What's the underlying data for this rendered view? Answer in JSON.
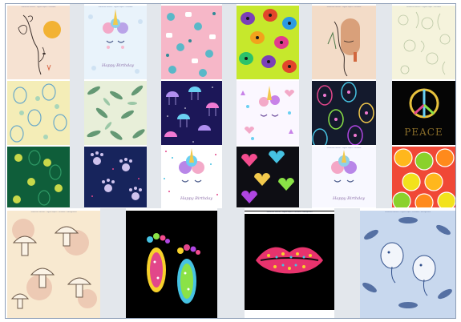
{
  "captions": {
    "top_small": "Seamless Pattern - Digital Paper - Printable",
    "wide": "Seamless Pattern - Digital Paper - Printable - Background"
  },
  "stamps": {
    "birthday_1": "Happy Birthday",
    "birthday_2": "Happy Birthday",
    "birthday_3": "Happy Birthday",
    "peace": "PEACE"
  },
  "tiles": [
    {
      "name": "line-art-face-flowers-pattern",
      "colors": {
        "bg": "#f6e2d2",
        "accent": "#f2b233"
      }
    },
    {
      "name": "unicorn-floral-card",
      "colors": {
        "bg": "#e9f3fb",
        "accent": "#f3a9c8"
      }
    },
    {
      "name": "pink-teal-doodle-pattern",
      "colors": {
        "bg": "#f6b7c8",
        "accent": "#5ab8c8"
      }
    },
    {
      "name": "colorful-ladybug-pattern",
      "colors": {
        "bg": "#c6e82c",
        "accent": "#7b3fb8"
      }
    },
    {
      "name": "abstract-face-art",
      "colors": {
        "bg": "#f3dcc8",
        "accent": "#d2673e"
      }
    },
    {
      "name": "pale-botanical-sketch-pattern",
      "colors": {
        "bg": "#f5f3dc",
        "accent": "#b9c6a3"
      }
    },
    {
      "name": "pastel-badminton-pattern",
      "colors": {
        "bg": "#f4edb7",
        "accent": "#6aa9c9"
      }
    },
    {
      "name": "green-leaf-swirl-pattern",
      "colors": {
        "bg": "#e8efd9",
        "accent": "#4d8a63"
      }
    },
    {
      "name": "jellyfish-night-pattern",
      "colors": {
        "bg": "#1c1758",
        "accent": "#b08ff0"
      }
    },
    {
      "name": "unicorn-face-confetti-pattern",
      "colors": {
        "bg": "#fbf7ff",
        "accent": "#c882e8"
      }
    },
    {
      "name": "neon-easter-eggs-pattern",
      "colors": {
        "bg": "#141a2d",
        "accent": "#e2468a"
      }
    },
    {
      "name": "peace-symbol-flowers",
      "colors": {
        "bg": "#050505",
        "accent": "#e8c23d"
      }
    },
    {
      "name": "green-tennis-pattern",
      "colors": {
        "bg": "#0f5e3a",
        "accent": "#c8d84a"
      }
    },
    {
      "name": "navy-paw-print-pattern",
      "colors": {
        "bg": "#17245c",
        "accent": "#cfc3ee"
      }
    },
    {
      "name": "unicorn-birthday-card",
      "colors": {
        "bg": "#ffffff",
        "accent": "#b886e8"
      }
    },
    {
      "name": "neon-hearts-pattern",
      "colors": {
        "bg": "#0e0e14",
        "accent": "#f44c8e"
      }
    },
    {
      "name": "unicorn-birthday-card-2",
      "colors": {
        "bg": "#f8f8ff",
        "accent": "#f4a6c6"
      }
    },
    {
      "name": "citrus-slices-pattern",
      "colors": {
        "bg": "#f04836",
        "accent": "#ffb71c"
      }
    },
    {
      "name": "mushroom-pattern",
      "colors": {
        "bg": "#f8e9d0",
        "accent": "#e7b6a3"
      }
    },
    {
      "name": "flower-footprints-art",
      "colors": {
        "bg": "#000000",
        "accent": "#f7d12b"
      }
    },
    {
      "name": "flower-lips-art",
      "colors": {
        "bg": "#000000",
        "accent": "#e8336d"
      }
    },
    {
      "name": "blue-elephant-pattern",
      "colors": {
        "bg": "#c8d8ee",
        "accent": "#2f4e8a"
      }
    }
  ]
}
